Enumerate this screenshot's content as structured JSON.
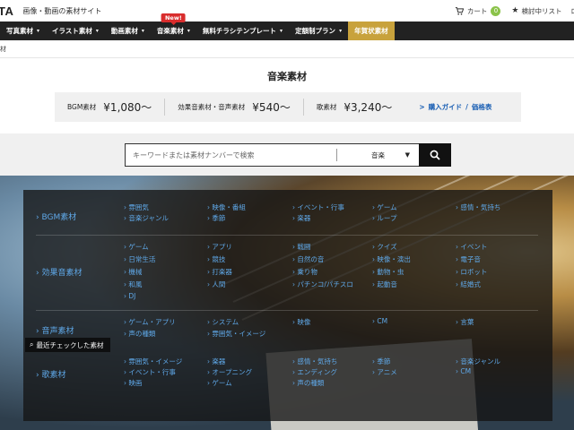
{
  "header": {
    "logo": "TA",
    "tagline": "画像・動画の素材サイト",
    "cart_label": "カート",
    "cart_count": "0",
    "wishlist_label": "検討中リスト",
    "more_label": "ロ"
  },
  "nav": {
    "items": [
      {
        "label": "写真素材",
        "caret": "▾"
      },
      {
        "label": "イラスト素材",
        "caret": "▾"
      },
      {
        "label": "動画素材",
        "caret": "▾"
      },
      {
        "label": "音楽素材",
        "caret": "▾",
        "badge": "New!"
      },
      {
        "label": "無料チラシテンプレート",
        "caret": "▾"
      },
      {
        "label": "定額制プラン",
        "caret": "▾"
      },
      {
        "label": "年賀状素材",
        "caret": ""
      }
    ],
    "highlight_color": "#c8a23c"
  },
  "breadcrumb": "材",
  "page": {
    "title": "音楽素材"
  },
  "pricing": [
    {
      "label": "BGM素材",
      "price": "¥1,080〜"
    },
    {
      "label": "効果音素材・音声素材",
      "price": "¥540〜"
    },
    {
      "label": "歌素材",
      "price": "¥3,240〜"
    }
  ],
  "guide": {
    "prefix": ">",
    "purchase_label": "購入ガイド",
    "sep": "/",
    "price_label": "価格表"
  },
  "search": {
    "placeholder": "キーワードまたは素材ナンバーで検索",
    "value": "",
    "category": "音楽",
    "dropdown_icon": "▼"
  },
  "categories": [
    {
      "name": "BGM素材",
      "links": [
        "雰囲気",
        "映像・番組",
        "イベント・行事",
        "ゲーム",
        "感情・気持ち",
        "音楽ジャンル",
        "季節",
        "楽器",
        "ループ"
      ]
    },
    {
      "name": "効果音素材",
      "links": [
        "ゲーム",
        "アプリ",
        "戦闘",
        "クイズ",
        "イベント",
        "日常生活",
        "競技",
        "自然の音",
        "映像・演出",
        "電子音",
        "機械",
        "打楽器",
        "乗り物",
        "動物・虫",
        "ロボット",
        "和風",
        "人間",
        "パチンコ/パチスロ",
        "起動音",
        "結婚式",
        "DJ"
      ]
    },
    {
      "name": "音声素材",
      "links": [
        "ゲーム・アプリ",
        "システム",
        "映像",
        "CM",
        "言葉",
        "声の種類",
        "雰囲気・イメージ"
      ]
    },
    {
      "name": "歌素材",
      "links": [
        "雰囲気・イメージ",
        "楽器",
        "感情・気持ち",
        "季節",
        "音楽ジャンル",
        "イベント・行事",
        "オープニング",
        "エンディング",
        "アニメ",
        "CM",
        "映画",
        "ゲーム",
        "声の種類"
      ]
    }
  ],
  "recent": {
    "label": "最近チェックした素材"
  }
}
